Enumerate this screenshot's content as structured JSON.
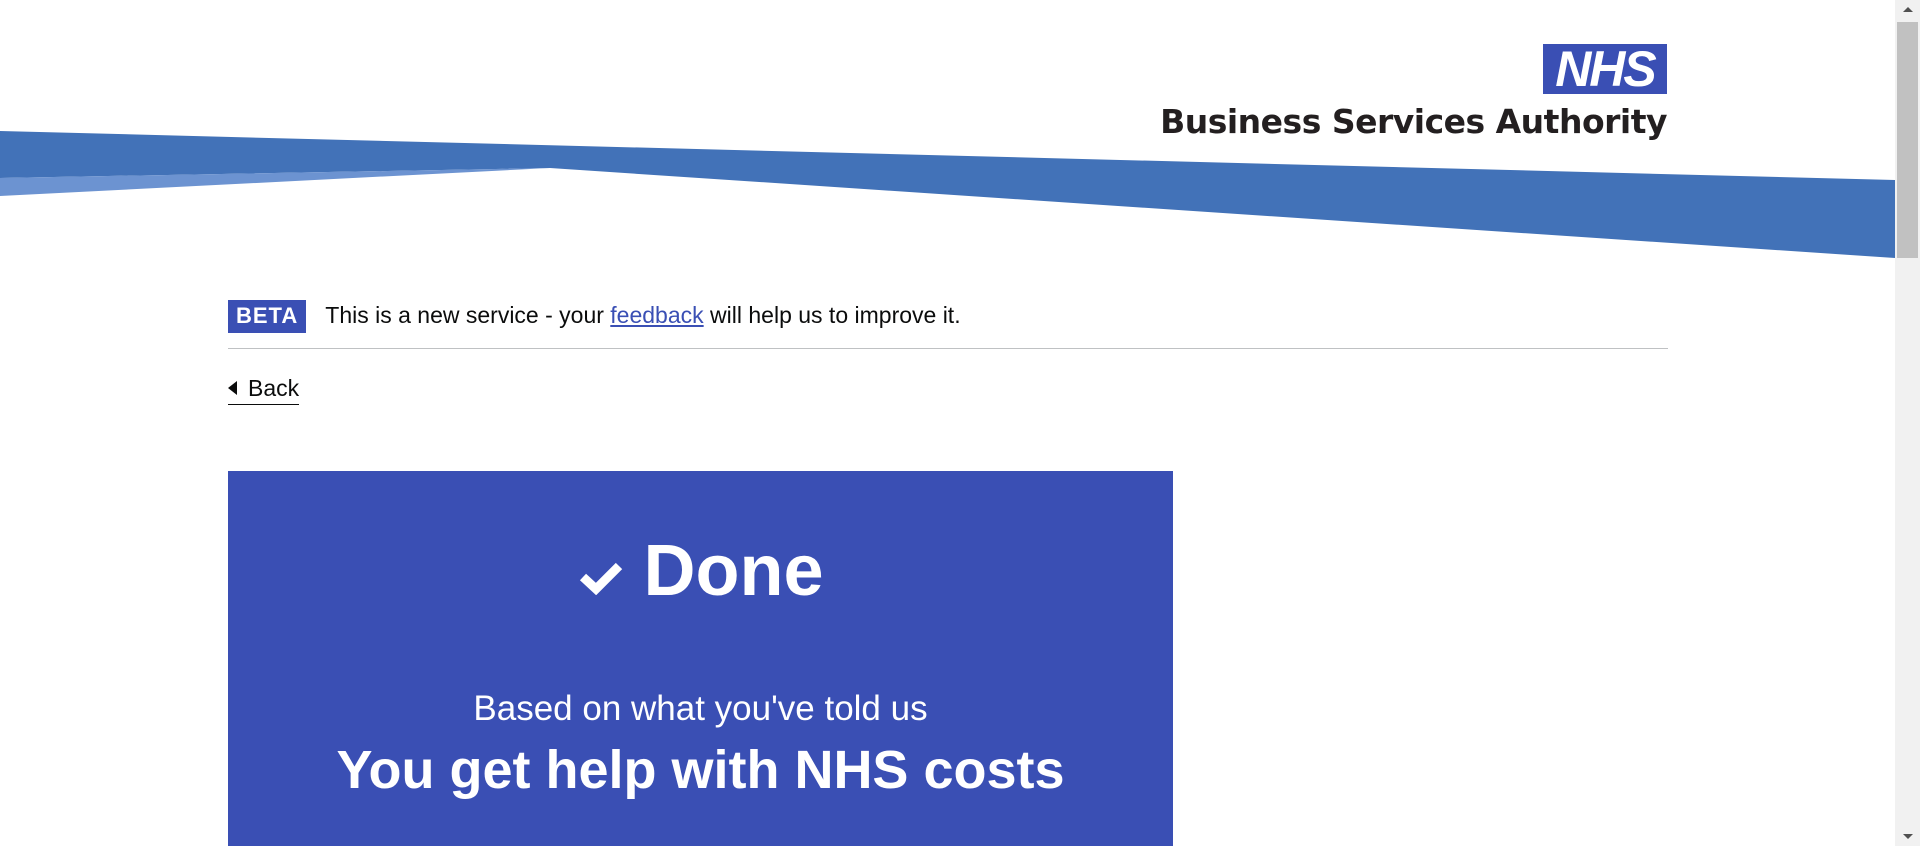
{
  "header": {
    "logo_mark": "NHS",
    "logo_text": "Business Services Authority"
  },
  "phase_banner": {
    "tag": "BETA",
    "text_before": "This is a new service - your ",
    "link": "feedback",
    "text_after": " will help us to improve it."
  },
  "back_link": {
    "label": "Back"
  },
  "confirmation": {
    "title": "Done",
    "icon": "check-icon",
    "intro": "Based on what you've told us",
    "result": "You get help with NHS costs"
  },
  "colors": {
    "brand_blue": "#3a4fb4",
    "swoosh_blue": "#4272b8",
    "swoosh_light": "#6c93d1"
  }
}
